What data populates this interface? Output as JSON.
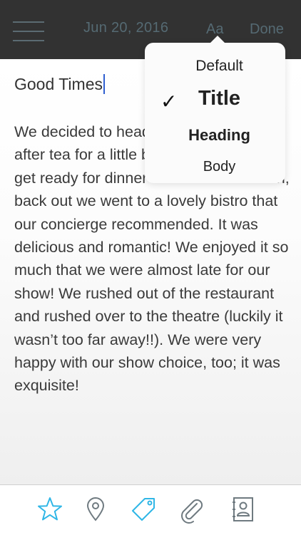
{
  "header": {
    "date": "Jun 20, 2016",
    "format_button": "Aa",
    "done_button": "Done"
  },
  "entry": {
    "title": "Good Times",
    "body": "We decided to head back to the hotel after tea for a little bit of a rest and to get ready for dinner and the show. Then, back out we went to a lovely bistro that our concierge recommended. It was delicious and romantic! We enjoyed it so much that we were almost late for our show! We rushed out of the restaurant and rushed over to the theatre (luckily it wasn’t too far away!!). We were very happy with our show choice, too; it was exquisite!"
  },
  "format_menu": {
    "options": [
      "Default",
      "Title",
      "Heading",
      "Body"
    ],
    "selected": "Title",
    "check": "✓"
  },
  "toolbar": {
    "icons": [
      "star-icon",
      "location-pin-icon",
      "tag-icon",
      "paperclip-icon",
      "contact-card-icon"
    ]
  },
  "colors": {
    "topbar": "#323232",
    "header_text": "#556a73",
    "accent": "#2fb6e6",
    "icon_gray": "#6f7a80",
    "cursor": "#2f5fd0"
  }
}
